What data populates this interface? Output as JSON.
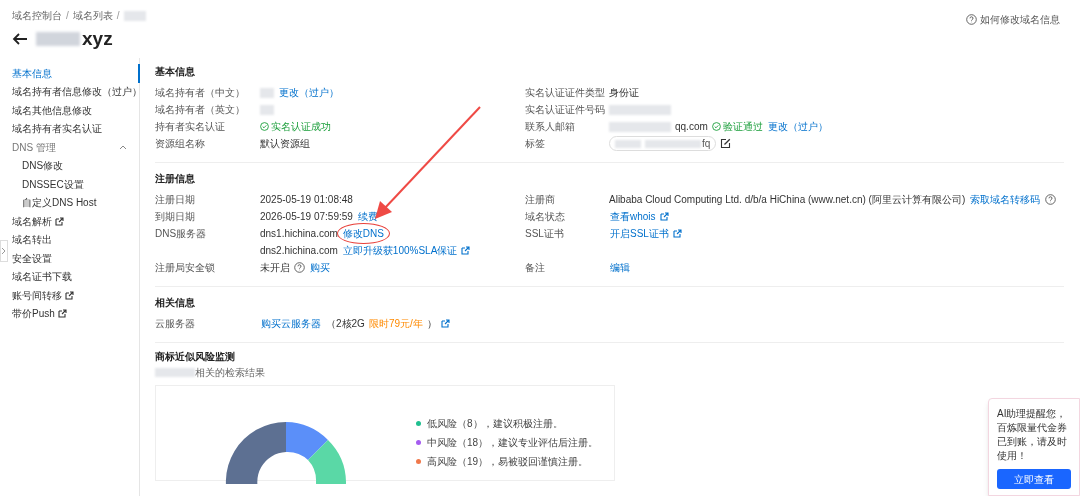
{
  "breadcrumb": {
    "items": [
      "域名控制台",
      "域名列表"
    ],
    "separator": "/"
  },
  "title": "xyz",
  "help_link": "如何修改域名信息",
  "sidebar": {
    "items": [
      {
        "label": "基本信息",
        "selected": true
      },
      {
        "label": "域名持有者信息修改（过户）",
        "selected": false
      },
      {
        "label": "域名其他信息修改",
        "selected": false
      },
      {
        "label": "域名持有者实名认证",
        "selected": false
      },
      {
        "label": "DNS 管理",
        "selected": false,
        "expanded": true,
        "children": [
          {
            "label": "DNS修改",
            "selected": false
          },
          {
            "label": "DNSSEC设置",
            "selected": false
          },
          {
            "label": "自定义DNS Host",
            "selected": false
          }
        ]
      },
      {
        "label": "域名解析",
        "selected": false,
        "external": true
      },
      {
        "label": "域名转出",
        "selected": false
      },
      {
        "label": "安全设置",
        "selected": false
      },
      {
        "label": "域名证书下载",
        "selected": false
      },
      {
        "label": "账号间转移",
        "selected": false,
        "external": true
      },
      {
        "label": "带价Push",
        "selected": false,
        "external": true
      }
    ]
  },
  "sections": [
    {
      "title": "基本信息",
      "rows": [
        {
          "left": {
            "label": "域名持有者（中文）",
            "lines": [
              [
                {
                  "kind": "blur_short"
                },
                {
                  "kind": "link",
                  "text": "更改（过户）"
                }
              ]
            ]
          },
          "right": {
            "label": "实名认证证件类型",
            "lines": [
              [
                {
                  "kind": "text",
                  "text": "身份证"
                }
              ]
            ]
          }
        },
        {
          "left": {
            "label": "域名持有者（英文）",
            "lines": [
              [
                {
                  "kind": "blur_short"
                }
              ]
            ]
          },
          "right": {
            "label": "实名认证证件号码",
            "lines": [
              [
                {
                  "kind": "blur_long"
                }
              ]
            ]
          }
        },
        {
          "left": {
            "label": "持有者实名认证",
            "lines": [
              [
                {
                  "kind": "success",
                  "text": "实名认证成功"
                }
              ]
            ]
          },
          "right": {
            "label": "联系人邮箱",
            "lines": [
              [
                {
                  "kind": "blur_long"
                },
                {
                  "kind": "text",
                  "text": "qq.com"
                },
                {
                  "kind": "success",
                  "text": "验证通过"
                },
                {
                  "kind": "link",
                  "text": "更改（过户）"
                }
              ]
            ]
          }
        },
        {
          "left": {
            "label": "资源组名称",
            "lines": [
              [
                {
                  "kind": "text",
                  "text": "默认资源组"
                }
              ]
            ]
          },
          "right": {
            "label": "标签",
            "lines": [
              [
                {
                  "kind": "tag",
                  "text": "fq"
                },
                {
                  "kind": "edit"
                }
              ]
            ]
          }
        }
      ]
    },
    {
      "title": "注册信息",
      "rows": [
        {
          "left": {
            "label": "注册日期",
            "lines": [
              [
                {
                  "kind": "text",
                  "text": "2025-05-19 01:08:48"
                }
              ]
            ]
          },
          "right": {
            "label": "注册商",
            "lines": [
              [
                {
                  "kind": "text",
                  "text": "Alibaba Cloud Computing Ltd. d/b/a HiChina (www.net.cn) (阿里云计算有限公司)"
                },
                {
                  "kind": "link",
                  "text": "索取域名转移码"
                },
                {
                  "kind": "help"
                }
              ]
            ]
          }
        },
        {
          "left": {
            "label": "到期日期",
            "lines": [
              [
                {
                  "kind": "text",
                  "text": "2026-05-19 07:59:59"
                },
                {
                  "kind": "link",
                  "text": "续费"
                }
              ]
            ]
          },
          "right": {
            "label": "域名状态",
            "lines": [
              [
                {
                  "kind": "link",
                  "text": "查看whois",
                  "external": true
                }
              ]
            ]
          }
        },
        {
          "left": {
            "label": "DNS服务器",
            "lines": [
              [
                {
                  "kind": "text",
                  "text": "dns1.hichina.com"
                },
                {
                  "kind": "link",
                  "text": "修改DNS",
                  "highlighted": true
                }
              ],
              [
                {
                  "kind": "text",
                  "text": "dns2.hichina.com"
                },
                {
                  "kind": "link",
                  "text": "立即升级获100%SLA保证",
                  "external": true
                }
              ]
            ]
          },
          "right": {
            "label": "SSL证书",
            "lines": [
              [
                {
                  "kind": "link",
                  "text": "开启SSL证书",
                  "external": true
                }
              ]
            ]
          }
        },
        {
          "left": {
            "label": "注册局安全锁",
            "lines": [
              [
                {
                  "kind": "text",
                  "text": "未开启"
                },
                {
                  "kind": "help"
                },
                {
                  "kind": "link",
                  "text": "购买"
                }
              ]
            ]
          },
          "right": {
            "label": "备注",
            "lines": [
              [
                {
                  "kind": "link",
                  "text": "编辑"
                }
              ]
            ]
          }
        }
      ]
    },
    {
      "title": "相关信息",
      "rows": [
        {
          "left": {
            "label": "云服务器",
            "lines": [
              [
                {
                  "kind": "link",
                  "text": "购买云服务器"
                },
                {
                  "kind": "text",
                  "text": "（2核2G"
                },
                {
                  "kind": "promo",
                  "text": "限时79元/年"
                },
                {
                  "kind": "text",
                  "text": "）"
                },
                {
                  "kind": "external"
                }
              ]
            ]
          }
        }
      ]
    }
  ],
  "trademark": {
    "title": "商标近似风险监测",
    "subtitle": "相关的检索结果",
    "legend": [
      {
        "text": "低风险（8），建议积极注册。",
        "color": "#1fbf8f"
      },
      {
        "text": "中风险（18），建议专业评估后注册。",
        "color": "#a55cf0"
      },
      {
        "text": "高风险（19），易被驳回谨慎注册。",
        "color": "#f0784a"
      }
    ]
  },
  "notice": {
    "text": "AI助理提醒您，百炼限量代金券已到账，请及时使用！",
    "button": "立即查看"
  }
}
